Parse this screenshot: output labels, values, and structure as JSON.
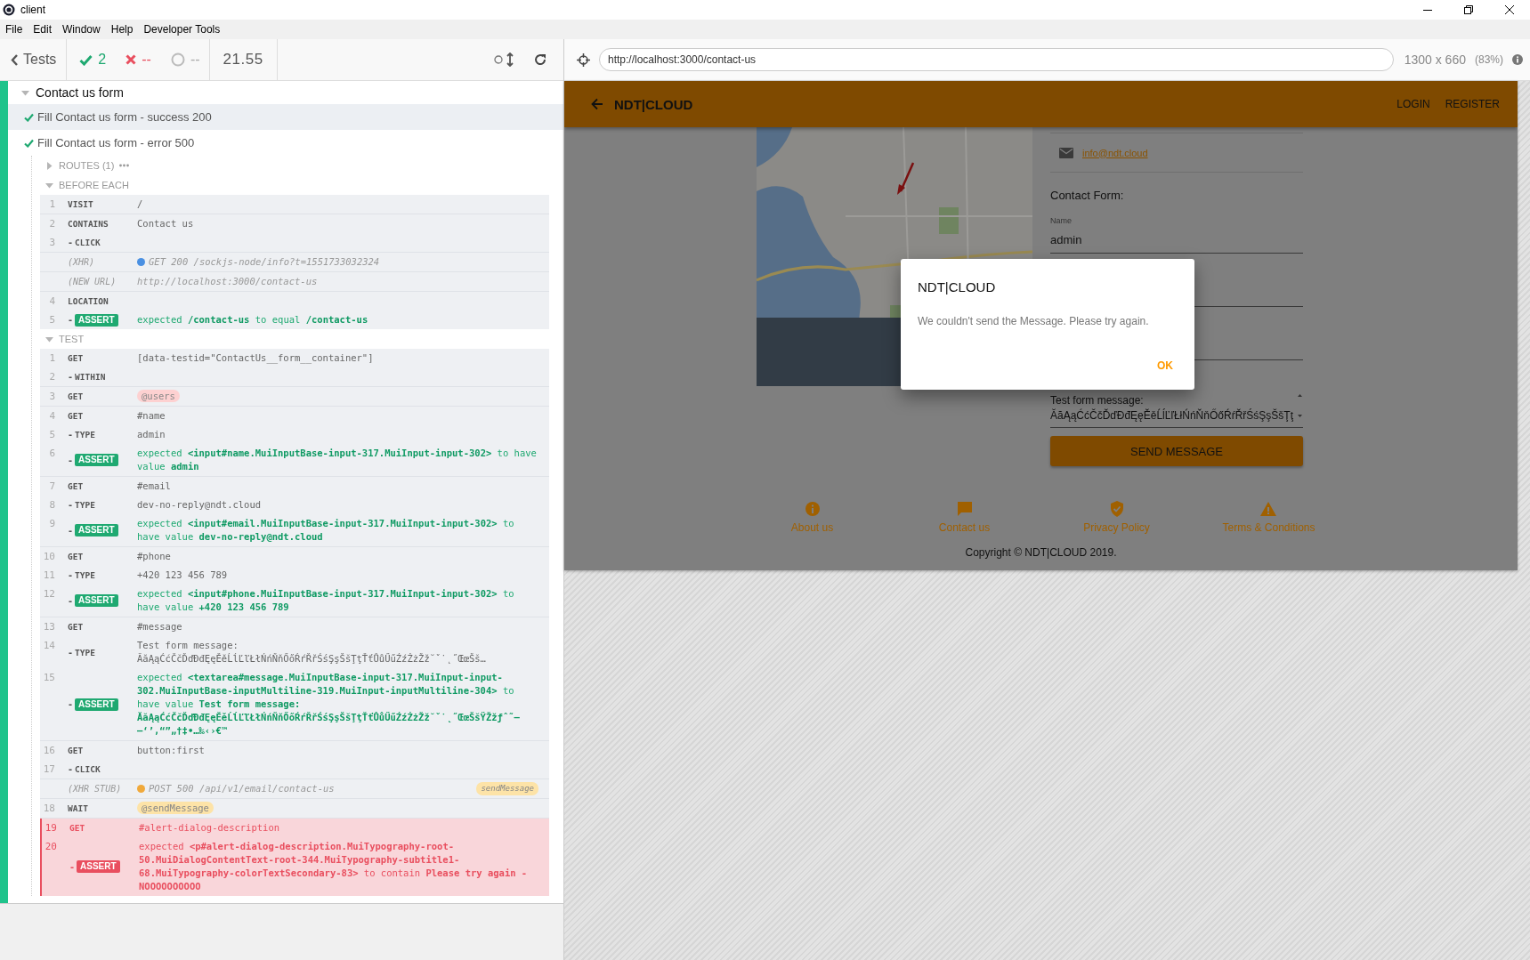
{
  "window": {
    "title": "client"
  },
  "menu": [
    "File",
    "Edit",
    "Window",
    "Help",
    "Developer Tools"
  ],
  "reporter": {
    "back_label": "Tests",
    "passed": "2",
    "failed": "--",
    "pending": "--",
    "duration": "21.55",
    "suite": {
      "title": "Contact us form",
      "expanded": true,
      "passed": true,
      "tests": [
        {
          "title": "Fill Contact us form - success 200",
          "passed": true,
          "selected": true
        },
        {
          "title": "Fill Contact us form - error 500",
          "passed": true,
          "selected": false,
          "routes": {
            "label": "ROUTES (1)",
            "expanded": false
          },
          "hooks": [
            {
              "title": "BEFORE EACH",
              "expanded": true,
              "groups": [
                {
                  "failed": false,
                  "commands": [
                    {
                      "kind": "command",
                      "number": "1",
                      "name": "VISIT",
                      "message": "/"
                    }
                  ]
                },
                {
                  "failed": false,
                  "commands": [
                    {
                      "kind": "command",
                      "number": "2",
                      "name": "CONTAINS",
                      "message": "Contact us"
                    },
                    {
                      "kind": "command",
                      "number": "3",
                      "prefix": "-",
                      "name": "CLICK"
                    }
                  ]
                },
                {
                  "failed": false,
                  "commands": [
                    {
                      "kind": "event",
                      "name": "(XHR)",
                      "color": "#4a90e2",
                      "message": "GET 200 /sockjs-node/info?t=1551733032324"
                    }
                  ]
                },
                {
                  "failed": false,
                  "commands": [
                    {
                      "kind": "event",
                      "name": "(NEW URL)",
                      "message": "http://localhost:3000/contact-us"
                    }
                  ]
                },
                {
                  "failed": false,
                  "commands": [
                    {
                      "kind": "command",
                      "number": "4",
                      "name": "LOCATION"
                    },
                    {
                      "kind": "assert",
                      "number": "5",
                      "prefix": "-",
                      "name": "ASSERT",
                      "message": "expected **/contact-us** to equal **/contact-us**"
                    }
                  ]
                }
              ]
            },
            {
              "title": "TEST",
              "expanded": true,
              "groups": [
                {
                  "failed": false,
                  "commands": [
                    {
                      "kind": "command",
                      "number": "1",
                      "name": "GET",
                      "message": "[data-testid=\"ContactUs__form__container\"]"
                    },
                    {
                      "kind": "command",
                      "number": "2",
                      "prefix": "-",
                      "name": "WITHIN"
                    }
                  ]
                },
                {
                  "failed": false,
                  "commands": [
                    {
                      "kind": "alias",
                      "number": "3",
                      "name": "GET",
                      "message": "@users",
                      "color": "#fdd1d1"
                    }
                  ]
                },
                {
                  "failed": false,
                  "commands": [
                    {
                      "kind": "command",
                      "number": "4",
                      "name": "GET",
                      "message": "#name"
                    },
                    {
                      "kind": "command",
                      "number": "5",
                      "prefix": "-",
                      "name": "TYPE",
                      "message": "admin"
                    },
                    {
                      "kind": "assert",
                      "number": "6",
                      "prefix": "-",
                      "name": "ASSERT",
                      "message": "expected **<input#name.MuiInputBase-input-317.MuiInput-input-302>** to have value **admin**"
                    }
                  ]
                },
                {
                  "failed": false,
                  "commands": [
                    {
                      "kind": "command",
                      "number": "7",
                      "name": "GET",
                      "message": "#email"
                    },
                    {
                      "kind": "command",
                      "number": "8",
                      "prefix": "-",
                      "name": "TYPE",
                      "message": "dev-no-reply@ndt.cloud"
                    },
                    {
                      "kind": "assert",
                      "number": "9",
                      "prefix": "-",
                      "name": "ASSERT",
                      "message": "expected **<input#email.MuiInputBase-input-317.MuiInput-input-302>** to have value **dev-no-reply@ndt.cloud**"
                    }
                  ]
                },
                {
                  "failed": false,
                  "commands": [
                    {
                      "kind": "command",
                      "number": "10",
                      "name": "GET",
                      "message": "#phone"
                    },
                    {
                      "kind": "command",
                      "number": "11",
                      "prefix": "-",
                      "name": "TYPE",
                      "message": "+420 123 456 789"
                    },
                    {
                      "kind": "assert",
                      "number": "12",
                      "prefix": "-",
                      "name": "ASSERT",
                      "message": "expected **<input#phone.MuiInputBase-input-317.MuiInput-input-302>** to have value **+420 123 456 789**"
                    }
                  ]
                },
                {
                  "failed": false,
                  "commands": [
                    {
                      "kind": "command",
                      "number": "13",
                      "name": "GET",
                      "message": "#message"
                    },
                    {
                      "kind": "command",
                      "number": "14",
                      "prefix": "-",
                      "name": "TYPE",
                      "message": "Test form message: ĂăĄąĆćČčĎďĐđĘęĚěĹĺĽľŁłŃńŇňŐőŔŕŘřŚśŞşŠšŢţŤťŮůŰűŹźŻżŽž˘ˇ˙˛˝ŒœŠš…"
                    },
                    {
                      "kind": "assert",
                      "number": "15",
                      "prefix": "-",
                      "name": "ASSERT",
                      "message": "expected **<textarea#message.MuiInputBase-input-317.MuiInput-input-302.MuiInputBase-inputMultiline-319.MuiInput-inputMultiline-304>** to have value **Test form message: ĂăĄąĆćČčĎďĐđĘęĚěĹĺĽľŁłŃńŇňŐőŔŕŘřŚśŞşŠšŢţŤťŮůŰűŹźŻżŽž˘ˇ˙˛˝ŒœŠšŸŽžƒˆ˜–—‘’‚“”„†‡•…‰‹›€™**"
                    }
                  ]
                },
                {
                  "failed": false,
                  "commands": [
                    {
                      "kind": "command",
                      "number": "16",
                      "name": "GET",
                      "message": "button:first"
                    },
                    {
                      "kind": "command",
                      "number": "17",
                      "prefix": "-",
                      "name": "CLICK"
                    }
                  ]
                },
                {
                  "failed": false,
                  "commands": [
                    {
                      "kind": "event",
                      "name": "(XHR STUB)",
                      "color": "#f0a93b",
                      "message": "POST 500 /api/v1/email/contact-us",
                      "tag": {
                        "text": "sendMessage",
                        "color": "#fde3a7"
                      }
                    }
                  ]
                },
                {
                  "failed": false,
                  "commands": [
                    {
                      "kind": "alias",
                      "number": "18",
                      "name": "WAIT",
                      "message": "@sendMessage",
                      "color": "#fde3a7"
                    }
                  ]
                },
                {
                  "failed": true,
                  "commands": [
                    {
                      "kind": "command",
                      "number": "19",
                      "name": "GET",
                      "message": "#alert-dialog-description"
                    },
                    {
                      "kind": "assert",
                      "number": "20",
                      "prefix": "-",
                      "name": "ASSERT",
                      "message": "expected **<p#alert-dialog-description.MuiTypography-root-50.MuiDialogContentText-root-344.MuiTypography-subtitle1-68.MuiTypography-colorTextSecondary-83>** to contain **Please try again - NOOOOOOOOOO**"
                    }
                  ]
                }
              ]
            }
          ]
        }
      ]
    }
  },
  "aut": {
    "url": "http://localhost:3000/contact-us",
    "viewport": "1300 x 660",
    "scale": "(83%)",
    "app": {
      "brand": "NDT|CLOUD",
      "nav": [
        "LOGIN",
        "REGISTER"
      ],
      "email": "info@ndt.cloud",
      "form_title": "Contact Form:",
      "fields": [
        {
          "kind": "text",
          "label": "Name",
          "value": "admin"
        },
        {
          "kind": "covered"
        },
        {
          "kind": "covered"
        },
        {
          "kind": "textarea",
          "value": "Test form message:\nĂăĄąĆćČčĎďĐđĘęĚěĹĺĽľŁłŃńŇňŐőŔŕŘřŚśŞşŠšŢţ"
        }
      ],
      "submit": "SEND MESSAGE",
      "footer": [
        "About us",
        "Contact us",
        "Privacy Policy",
        "Terms & Conditions"
      ],
      "copyright": "Copyright © NDT|CLOUD 2019."
    },
    "dialog": {
      "title": "NDT|CLOUD",
      "message": "We couldn't send the Message. Please try again.",
      "button": "OK"
    }
  }
}
